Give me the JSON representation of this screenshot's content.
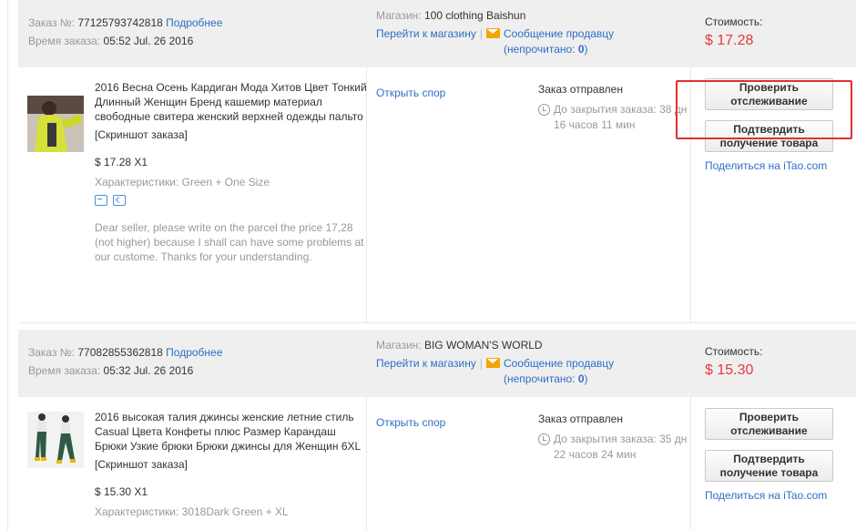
{
  "labels": {
    "order_no": "Заказ №:",
    "details": "Подробнее",
    "order_time": "Время заказа:",
    "store": "Магазин:",
    "go_store": "Перейти к магазину",
    "message_seller": "Сообщение продавцу",
    "unread_prefix": "(непрочитано: ",
    "unread_suffix": ")",
    "cost": "Стоимость:",
    "open_dispute": "Открыть спор",
    "track": "Проверить отслеживание",
    "confirm": "Подтвердить получение товара",
    "share_prefix": "Поделиться на ",
    "share_site": "iTao.com",
    "screenshot": "[Скриншот заказа]",
    "specs_prefix": "Характеристики: "
  },
  "orders": [
    {
      "number": "77125793742818",
      "time": "05:52 Jul. 26 2016",
      "store_name": "100 clothing Baishun",
      "unread": "0",
      "cost": "$ 17.28",
      "product_title": "2016 Весна Осень Кардиган Мода Хитов Цвет Тонкий Длинный Женщин Бренд кашемир материал свободные свитера женский верхней одежды пальто",
      "price_qty": "$ 17.28 X1",
      "specs": "Green + One Size",
      "note": "Dear seller, please write on the parcel the price 17,28 (not higher) because I shall can have some problems at our custome. Thanks for your understanding.",
      "status": "Заказ отправлен",
      "timer": "До закрытия заказа: 38 дн 16 часов 11 мин"
    },
    {
      "number": "77082855362818",
      "time": "05:32 Jul. 26 2016",
      "store_name": "BIG WOMAN'S WORLD",
      "unread": "0",
      "cost": "$ 15.30",
      "product_title": "2016 высокая талия джинсы женские летние стиль Casual Цвета Конфеты плюс Размер Карандаш Брюки Узкие брюки Брюки джинсы для Женщин 6XL",
      "price_qty": "$ 15.30 X1",
      "specs": "3018Dark Green + XL",
      "status": "Заказ отправлен",
      "timer": "До закрытия заказа: 35 дн 22 часов 24 мин"
    }
  ],
  "icons": [
    "envelope-icon",
    "clock-icon",
    "shipping-icon",
    "return-icon"
  ],
  "colors": {
    "price": "#e4393c",
    "link": "#2e6ec6",
    "header_bg": "#efefef",
    "highlight": "#e03030"
  }
}
